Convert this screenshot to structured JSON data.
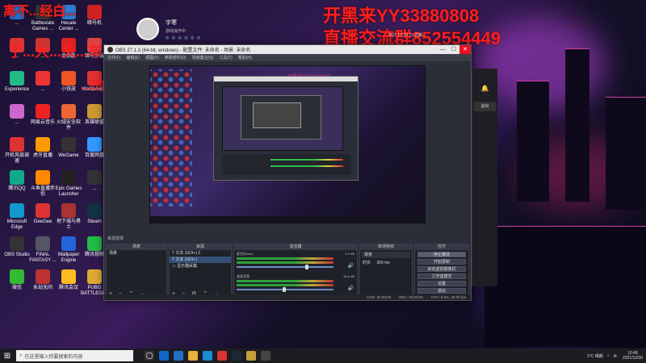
{
  "overlay": {
    "top_left": "离不...经白...",
    "top_right_line1": "开黑来YY33880808",
    "top_right_line2": "直播交流群852554449",
    "left_mid": "了...大...头...车",
    "left_low": "...的...头...车"
  },
  "streamer": {
    "name": "宇寒",
    "subtitle": "游戏操作中",
    "icons_line": "◎ ◎ ◎ ◎ ◎ ◎",
    "fans_text": "2021.12.30 11 直播..."
  },
  "desktop_icons": [
    {
      "label": "...",
      "color": "#1c6fd1"
    },
    {
      "label": "Battlestate Games ...",
      "color": "#333"
    },
    {
      "label": "Hecate Center ...",
      "color": "#2d7bd1"
    },
    {
      "label": "暗号机",
      "color": "#c22"
    },
    {
      "label": "...",
      "color": "#d33"
    },
    {
      "label": "...",
      "color": "#c33"
    },
    {
      "label": "金钥匙",
      "color": "#d22"
    },
    {
      "label": "暗号外服",
      "color": "#d44"
    },
    {
      "label": "Experience",
      "color": "#2b8"
    },
    {
      "label": "...",
      "color": "#e33"
    },
    {
      "label": "小铁皮",
      "color": "#e52"
    },
    {
      "label": "WeGame版",
      "color": "#d33"
    },
    {
      "label": "...",
      "color": "#c6c"
    },
    {
      "label": "网易云音乐",
      "color": "#e22"
    },
    {
      "label": "火绒安全软件",
      "color": "#e63"
    },
    {
      "label": "英雄联盟",
      "color": "#c93"
    },
    {
      "label": "开机风扇调速",
      "color": "#d33"
    },
    {
      "label": "虎牙直播",
      "color": "#f90"
    },
    {
      "label": "WeGame",
      "color": "#333"
    },
    {
      "label": "百度网盘",
      "color": "#39f"
    },
    {
      "label": "腾讯QQ",
      "color": "#1a8"
    },
    {
      "label": "斗鱼直播伴侣",
      "color": "#f80"
    },
    {
      "label": "Epic Games Launcher",
      "color": "#222"
    },
    {
      "label": "...",
      "color": "#333"
    },
    {
      "label": "Microsoft Edge",
      "color": "#19c"
    },
    {
      "label": "GeeGee",
      "color": "#d33"
    },
    {
      "label": "地下城与勇士",
      "color": "#a33"
    },
    {
      "label": "Steam",
      "color": "#134"
    },
    {
      "label": "OBS Studio",
      "color": "#333"
    },
    {
      "label": "FINAL FANTASY ...",
      "color": "#556"
    },
    {
      "label": "Wallpaper Engine",
      "color": "#26d"
    },
    {
      "label": "腾讯视频",
      "color": "#2b4"
    },
    {
      "label": "微信",
      "color": "#3b3"
    },
    {
      "label": "永劫无间",
      "color": "#b33"
    },
    {
      "label": "腾讯会议",
      "color": "#fb2"
    },
    {
      "label": "PUBG BATTLEGR...",
      "color": "#da3"
    }
  ],
  "obs": {
    "title": "OBS 27.1.3 (64-bit, windows) - 配置文件: 未命名 - 场景: 未命名",
    "menu": [
      "文件(F)",
      "编辑(E)",
      "视图(V)",
      "停靠部件(D)",
      "场景集合(S)",
      "工具(T)",
      "帮助(H)"
    ],
    "dock_label": "来源选择",
    "scenes_header": "场景",
    "scene_item": "场景",
    "sources_header": "来源",
    "sources": [
      "文本 (GDI+) 2",
      "文本 (GDI+)",
      "显示器采集"
    ],
    "mixer_header": "混音器",
    "mixer_channels": [
      {
        "name": "麦克风/Aux",
        "db": "0.0 dB"
      },
      {
        "name": "桌面音频",
        "db": "-16.6 dB"
      }
    ],
    "transition_header": "转场特效",
    "transition_value": "渐变",
    "duration_label": "时长",
    "duration_value": "300 ms",
    "controls_header": "控件",
    "controls": [
      "停止推流",
      "开始录制",
      "启动虚拟摄像机",
      "工作室模式",
      "设置",
      "退出"
    ],
    "status": [
      "LIVE: 00:00:00",
      "REC: 00:00:00",
      "CPU: 0.0%, 30.00 fps"
    ],
    "window_controls": [
      "—",
      "☐",
      "✕"
    ]
  },
  "right_panel": {
    "exit_button": "退出"
  },
  "taskbar": {
    "search_placeholder": "在这里输入你要搜索的内容",
    "weather": "3°C 晴朗",
    "time": "10:48",
    "date": "2021/12/30"
  },
  "colors": {
    "overlay_red": "#ff1f1f",
    "obs_bg": "#2b2e38",
    "taskbar_bg": "#1c1c22"
  }
}
